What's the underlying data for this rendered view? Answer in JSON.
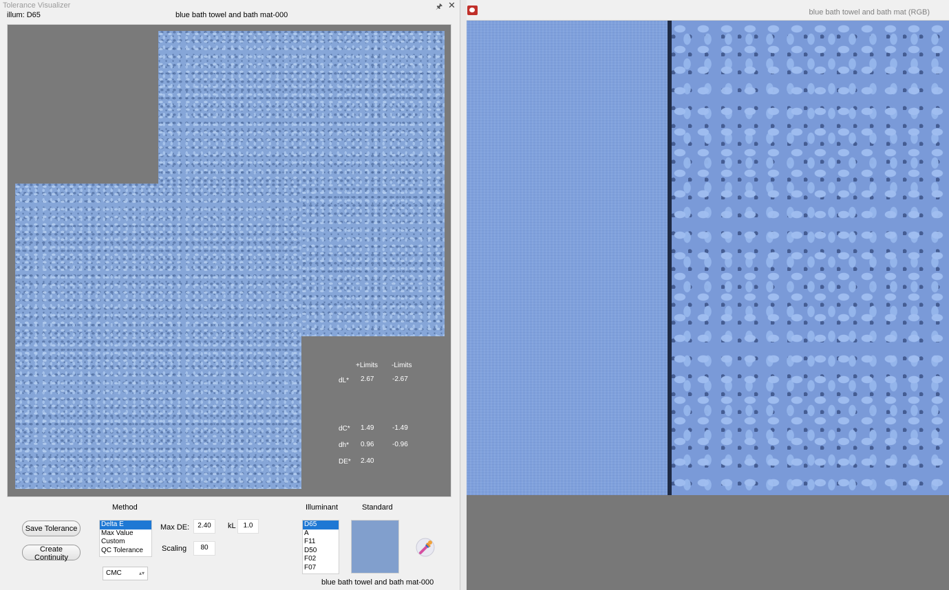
{
  "left_panel": {
    "window_title": "Tolerance Visualizer",
    "illum_label": "illum: D65",
    "sample_title": "blue bath towel and bath mat-000",
    "limits": {
      "plus_header": "+Limits",
      "minus_header": "-Limits",
      "rows": [
        {
          "label": "dL*",
          "plus": "2.67",
          "minus": "-2.67"
        },
        {
          "label": "dC*",
          "plus": "1.49",
          "minus": "-1.49"
        },
        {
          "label": "dh*",
          "plus": "0.96",
          "minus": "-0.96"
        },
        {
          "label": "DE*",
          "plus": "2.40",
          "minus": ""
        }
      ]
    },
    "controls": {
      "save_tolerance": "Save Tolerance",
      "create_continuity": "Create Continuity",
      "method_label": "Method",
      "methods": [
        "Delta E",
        "Max Value",
        "Custom",
        "QC Tolerance"
      ],
      "selected_method": "Delta E",
      "formula_select": "CMC",
      "max_de_label": "Max DE:",
      "max_de_value": "2.40",
      "kl_label": "kL",
      "kl_value": "1.0",
      "scaling_label": "Scaling",
      "scaling_value": "80",
      "illuminant_label": "Illuminant",
      "illuminants": [
        "D65",
        "A",
        "F11",
        "D50",
        "F02",
        "F07"
      ],
      "selected_illuminant": "D65",
      "standard_label": "Standard",
      "standard_color": "#819fcd",
      "standard_caption": "blue bath towel and bath mat-000"
    }
  },
  "right_panel": {
    "title": "blue bath towel and bath mat (RGB)"
  },
  "colors": {
    "canvas_bg": "#7a7a7a",
    "texture_blue": "#86a6d8",
    "selection_blue": "#1e78d4"
  }
}
